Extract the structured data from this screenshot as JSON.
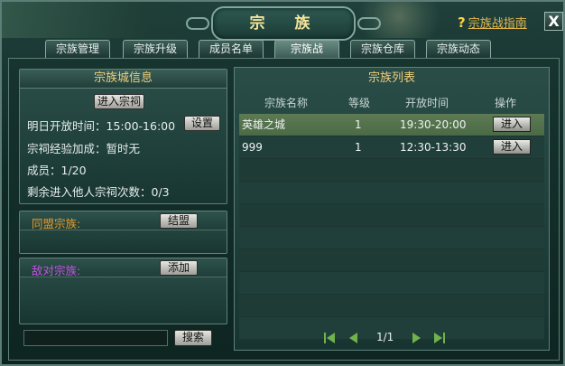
{
  "window": {
    "title": "宗　族",
    "guide_link": "宗族战指南",
    "close_label": "X"
  },
  "tabs": [
    {
      "label": "宗族管理",
      "active": false
    },
    {
      "label": "宗族升级",
      "active": false
    },
    {
      "label": "成员名单",
      "active": false
    },
    {
      "label": "宗族战",
      "active": true
    },
    {
      "label": "宗族仓库",
      "active": false
    },
    {
      "label": "宗族动态",
      "active": false
    }
  ],
  "city_info": {
    "title": "宗族城信息",
    "enter_button": "进入宗祠",
    "open_time": "明日开放时间：15:00-16:00",
    "settings_button": "设置",
    "exp_bonus": "宗祠经验加成：暂时无",
    "members": "成员：1/20",
    "remaining_entries": "剩余进入他人宗祠次数：0/3"
  },
  "alliance": {
    "label": "同盟宗族:",
    "button": "结盟",
    "label_color": "#e89a2e"
  },
  "enemy": {
    "label": "敌对宗族:",
    "button": "添加",
    "label_color": "#c850e8"
  },
  "search": {
    "value": "",
    "button": "搜索"
  },
  "clan_list": {
    "title": "宗族列表",
    "columns": [
      "宗族名称",
      "等级",
      "开放时间",
      "操作"
    ],
    "rows": [
      {
        "name": "英雄之城",
        "level": "1",
        "time": "19:30-20:00",
        "action": "进入",
        "selected": true
      },
      {
        "name": "999",
        "level": "1",
        "time": "12:30-13:30",
        "action": "进入",
        "selected": false
      }
    ],
    "empty_rows": 8,
    "page": "1/1"
  },
  "colors": {
    "title_text": "#f5e39a",
    "section_title": "#efcf7c",
    "selected_row": "#5d7a54"
  }
}
